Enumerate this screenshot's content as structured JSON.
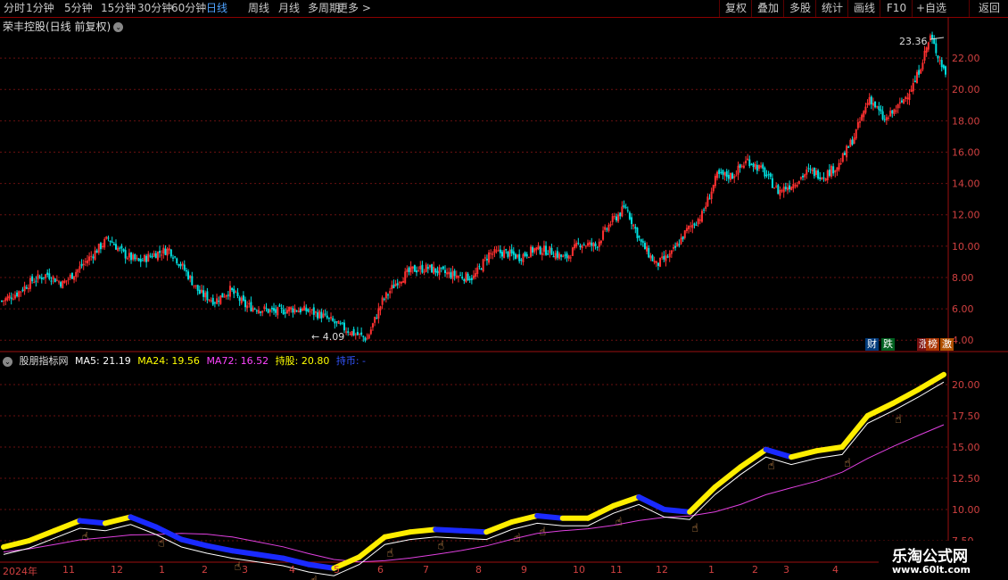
{
  "toolbar": {
    "periods": [
      "分时",
      "1分钟",
      "5分钟",
      "15分钟",
      "30分钟",
      "60分钟",
      "日线",
      "周线",
      "月线",
      "多周期",
      "更多 >"
    ],
    "active": "日线",
    "right_buttons": [
      "复权",
      "叠加",
      "多股",
      "统计",
      "画线",
      "F10",
      "+自选",
      "返回"
    ]
  },
  "chart": {
    "title": "荣丰控股(日线 前复权)",
    "max_label": "23.36",
    "min_label": "4.09",
    "y_ticks": [
      "22.00",
      "20.00",
      "18.00",
      "16.00",
      "14.00",
      "12.00",
      "10.00",
      "8.00",
      "6.00",
      "4.00"
    ],
    "badges": [
      "财",
      "跌",
      "涨",
      "榜",
      "激"
    ]
  },
  "indicator": {
    "name": "股朋指标网",
    "ma5": "MA5: 21.19",
    "ma24": "MA24: 19.56",
    "ma72": "MA72: 16.52",
    "hold": "持股: 20.80",
    "coin": "持币: -",
    "y_ticks": [
      "20.00",
      "17.50",
      "15.00",
      "12.50",
      "10.00",
      "7.50"
    ],
    "colors": {
      "ma5": "#ffffff",
      "ma24": "#ffff00",
      "ma72": "#ff00ff",
      "hold": "#ffff00",
      "coin": "#0000ff"
    }
  },
  "time_axis": [
    "2024年",
    "11",
    "12",
    "1",
    "2",
    "3",
    "4",
    "5",
    "6",
    "7",
    "8",
    "9",
    "10",
    "11",
    "12",
    "1",
    "2",
    "3",
    "4"
  ],
  "watermark": {
    "line1": "乐淘公式网",
    "line2": "www.60lt.com"
  },
  "chart_data": {
    "type": "line",
    "title": "荣丰控股(日线 前复权)",
    "y_range": [
      3.5,
      24
    ],
    "price": [
      6.5,
      7.0,
      7.8,
      8.2,
      7.6,
      8.5,
      9.5,
      10.5,
      9.5,
      9.0,
      9.5,
      9.8,
      8.5,
      7.0,
      6.5,
      7.2,
      6.2,
      6.0,
      5.8,
      6.0,
      5.9,
      5.6,
      5.0,
      4.5,
      4.09,
      6.5,
      7.8,
      8.5,
      8.6,
      8.3,
      8.1,
      8.0,
      9.5,
      9.6,
      9.3,
      9.8,
      9.7,
      9.2,
      10.2,
      10.0,
      11.5,
      12.5,
      10.2,
      8.8,
      9.5,
      11.0,
      12.0,
      14.5,
      14.5,
      15.5,
      14.8,
      13.5,
      14.0,
      14.8,
      14.5,
      15.2,
      17.0,
      19.5,
      18.0,
      19.0,
      20.5,
      23.36,
      21.0
    ],
    "indicator_range": [
      6.5,
      21.5
    ],
    "hold_line": [
      7.0,
      7.5,
      8.3,
      9.1,
      8.9,
      9.4,
      8.6,
      7.6,
      7.1,
      6.7,
      6.4,
      6.1,
      5.6,
      5.3,
      6.2,
      7.8,
      8.2,
      8.4,
      8.3,
      8.2,
      9.0,
      9.5,
      9.3,
      9.3,
      10.3,
      11.0,
      10.0,
      9.8,
      11.8,
      13.4,
      14.8,
      14.2,
      14.7,
      15.0,
      17.5,
      18.5,
      19.6,
      20.8
    ]
  }
}
